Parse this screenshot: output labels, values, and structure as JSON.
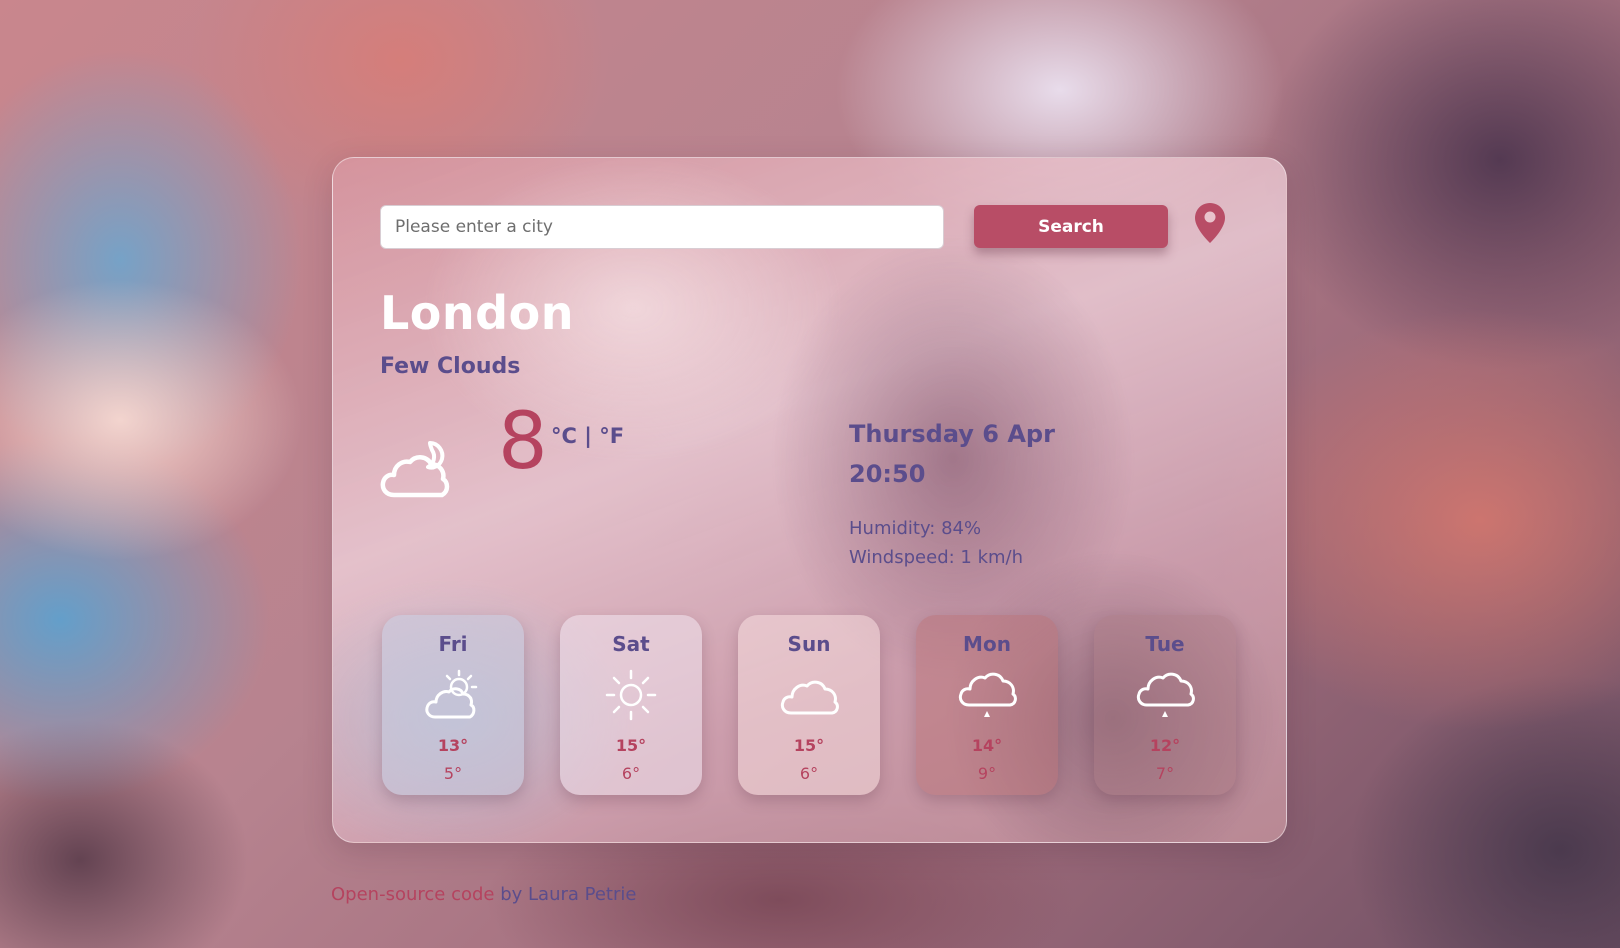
{
  "search": {
    "placeholder": "Please enter a city",
    "value": "",
    "button_label": "Search",
    "location_icon": "map-pin-icon"
  },
  "current": {
    "city": "London",
    "description": "Few Clouds",
    "icon": "few-clouds-night-icon",
    "temperature": "8",
    "unit_celsius": "°C",
    "unit_separator": " | ",
    "unit_fahrenheit": "°F",
    "date": "Thursday 6 Apr",
    "time": "20:50",
    "humidity": "Humidity: 84%",
    "windspeed": "Windspeed: 1 km/h"
  },
  "forecast": [
    {
      "day": "Fri",
      "icon": "partly-cloudy-day-icon",
      "high": "13°",
      "low": "5°"
    },
    {
      "day": "Sat",
      "icon": "sun-icon",
      "high": "15°",
      "low": "6°"
    },
    {
      "day": "Sun",
      "icon": "cloud-icon",
      "high": "15°",
      "low": "6°"
    },
    {
      "day": "Mon",
      "icon": "light-rain-icon",
      "high": "14°",
      "low": "9°"
    },
    {
      "day": "Tue",
      "icon": "light-rain-icon",
      "high": "12°",
      "low": "7°"
    }
  ],
  "footer": {
    "link_text": "Open-source code",
    "by_text": " by ",
    "author": "Laura Petrie"
  },
  "colors": {
    "accent": "#b84d66",
    "temperature": "#b5435f",
    "text_purple": "#5b4d8c",
    "city_text": "#ffffff"
  }
}
